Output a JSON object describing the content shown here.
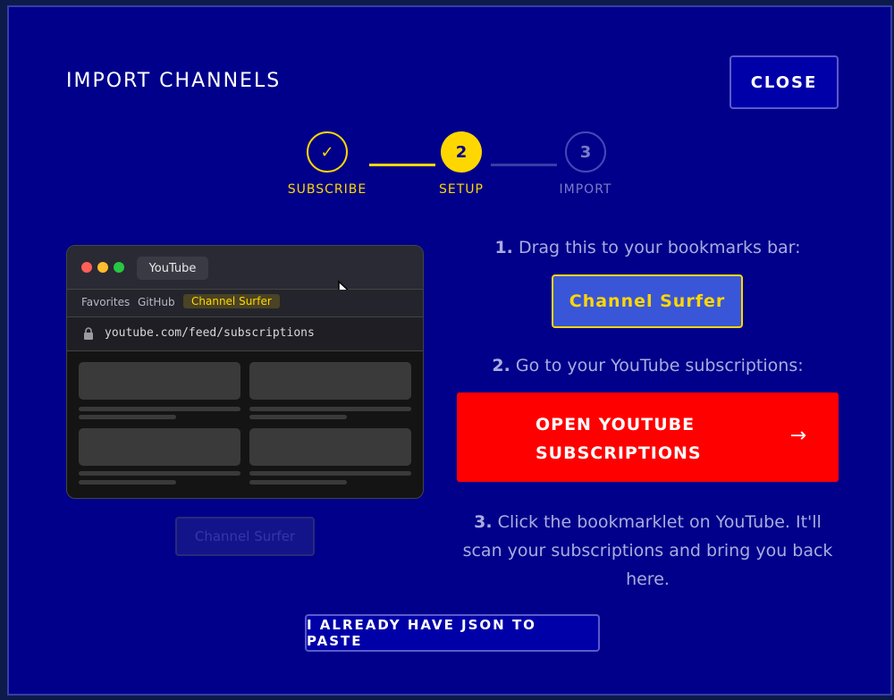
{
  "modal": {
    "title": "IMPORT CHANNELS",
    "close_label": "CLOSE"
  },
  "stepper": {
    "steps": [
      {
        "label": "SUBSCRIBE",
        "marker": "✓",
        "state": "complete"
      },
      {
        "label": "SETUP",
        "marker": "2",
        "state": "active"
      },
      {
        "label": "IMPORT",
        "marker": "3",
        "state": "pending"
      }
    ]
  },
  "browser_mock": {
    "tab_title": "YouTube",
    "bookmarks": [
      "Favorites",
      "GitHub",
      "Channel Surfer"
    ],
    "url": "youtube.com/feed/subscriptions",
    "draggable_label": "Channel Surfer"
  },
  "instructions": {
    "step1_num": "1.",
    "step1_text": "Drag this to your bookmarks bar:",
    "bookmarklet_label": "Channel Surfer",
    "step2_num": "2.",
    "step2_text": "Go to your YouTube subscriptions:",
    "open_youtube_label": "OPEN YOUTUBE SUBSCRIPTIONS",
    "arrow_icon": "→",
    "step3_num": "3.",
    "step3_text": "Click the bookmarklet on YouTube. It'll scan your subscriptions and bring you back here."
  },
  "footer": {
    "paste_json_label": "I ALREADY HAVE JSON TO PASTE"
  },
  "colors": {
    "modal_bg": "#00008a",
    "accent_yellow": "#ffd700",
    "youtube_red": "#ff0000",
    "muted_text": "#a9acdf"
  }
}
